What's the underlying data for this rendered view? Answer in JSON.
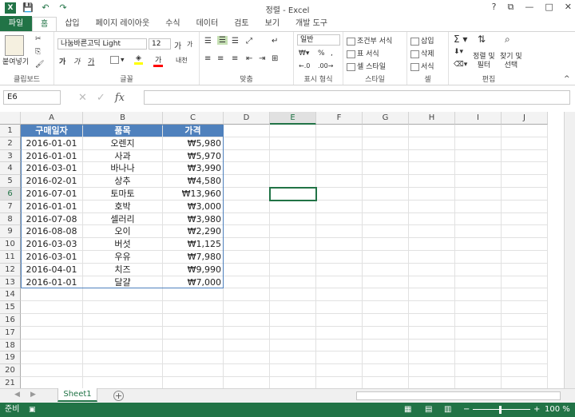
{
  "title": "정렬 - Excel",
  "qat": {
    "save": "💾",
    "undo": "↶",
    "redo": "↷"
  },
  "window_controls": {
    "help": "?",
    "restore": "⧉",
    "minimize": "—",
    "maximize": "□",
    "close": "✕"
  },
  "tabs": [
    "파일",
    "홈",
    "삽입",
    "페이지 레이아웃",
    "수식",
    "데이터",
    "검토",
    "보기",
    "개발 도구"
  ],
  "active_tab": "홈",
  "ribbon": {
    "clipboard": {
      "label": "클립보드",
      "paste": "붙여넣기"
    },
    "font": {
      "label": "글꼴",
      "name": "나눔바른고딕 Light",
      "size": "12",
      "bold": "가",
      "italic": "가",
      "underline": "가",
      "grow": "가",
      "shrink": "가",
      "color_glyph": "가",
      "phonetic": "내천"
    },
    "alignment": {
      "label": "맞춤"
    },
    "number": {
      "label": "표시 형식",
      "format": "일반",
      "percent": "%",
      "comma": ","
    },
    "styles": {
      "label": "스타일",
      "conditional": "조건부 서식",
      "table": "표 서식",
      "cell_styles": "셀 스타일"
    },
    "cells": {
      "label": "셀",
      "insert": "삽입",
      "delete": "삭제",
      "format": "서식"
    },
    "editing": {
      "label": "편집",
      "sort": "정렬 및",
      "sort2": "필터",
      "find": "찾기 및",
      "find2": "선택"
    }
  },
  "formula_bar": {
    "name_box": "E6",
    "cancel": "✕",
    "enter": "✓",
    "fx": "fx",
    "value": ""
  },
  "columns": [
    "A",
    "B",
    "C",
    "D",
    "E",
    "F",
    "G",
    "H",
    "I",
    "J"
  ],
  "rows": [
    "1",
    "2",
    "3",
    "4",
    "5",
    "6",
    "7",
    "8",
    "9",
    "10",
    "11",
    "12",
    "13",
    "14",
    "15",
    "16",
    "17",
    "18",
    "19",
    "20",
    "21"
  ],
  "active_cell": "E6",
  "table": {
    "headers": [
      "구매일자",
      "품목",
      "가격"
    ],
    "rows": [
      [
        "2016-01-01",
        "오렌지",
        "₩5,980"
      ],
      [
        "2016-01-01",
        "사과",
        "₩5,970"
      ],
      [
        "2016-03-01",
        "바나나",
        "₩3,990"
      ],
      [
        "2016-02-01",
        "상추",
        "₩4,580"
      ],
      [
        "2016-07-01",
        "토마토",
        "₩13,960"
      ],
      [
        "2016-01-01",
        "호박",
        "₩3,000"
      ],
      [
        "2016-07-08",
        "셀러리",
        "₩3,980"
      ],
      [
        "2016-08-08",
        "오이",
        "₩2,290"
      ],
      [
        "2016-03-03",
        "버섯",
        "₩1,125"
      ],
      [
        "2016-03-01",
        "우유",
        "₩7,980"
      ],
      [
        "2016-04-01",
        "치즈",
        "₩9,990"
      ],
      [
        "2016-01-01",
        "달걀",
        "₩7,000"
      ]
    ]
  },
  "sheet_tab": "Sheet1",
  "add_sheet": "+",
  "status": {
    "ready": "준비",
    "zoom": "100 %",
    "zoom_minus": "−",
    "zoom_plus": "+"
  },
  "colors": {
    "accent": "#217346",
    "table_header": "#4f81bd"
  }
}
